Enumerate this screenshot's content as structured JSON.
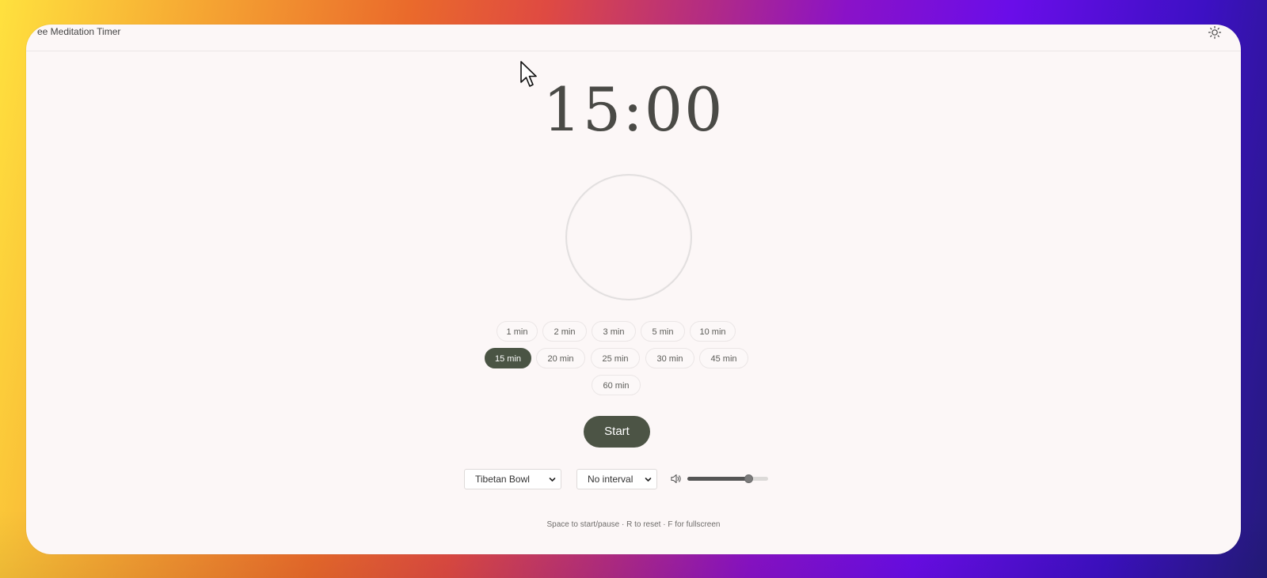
{
  "app": {
    "title": "ee Meditation Timer"
  },
  "icons": {
    "theme_toggle": "sun-icon",
    "volume": "speaker-icon",
    "cursor": "mouse-pointer-icon",
    "select_chevron": "chevron-down-icon"
  },
  "colors": {
    "accent": "#4a5444",
    "background": "#fcf7f7",
    "timer_text": "#4a4a46"
  },
  "timer": {
    "display": "15:00"
  },
  "durations": [
    {
      "label": "1 min",
      "selected": false
    },
    {
      "label": "2 min",
      "selected": false
    },
    {
      "label": "3 min",
      "selected": false
    },
    {
      "label": "5 min",
      "selected": false
    },
    {
      "label": "10 min",
      "selected": false
    },
    {
      "label": "15 min",
      "selected": true
    },
    {
      "label": "20 min",
      "selected": false
    },
    {
      "label": "25 min",
      "selected": false
    },
    {
      "label": "30 min",
      "selected": false
    },
    {
      "label": "45 min",
      "selected": false
    },
    {
      "label": "60 min",
      "selected": false
    }
  ],
  "controls": {
    "start_label": "Start",
    "sound_select": {
      "value": "Tibetan Bowl"
    },
    "interval_select": {
      "value": "No interval"
    },
    "volume": {
      "level_fraction": 0.75
    }
  },
  "footer": {
    "shortcuts": "Space to start/pause · R to reset · F for fullscreen"
  }
}
